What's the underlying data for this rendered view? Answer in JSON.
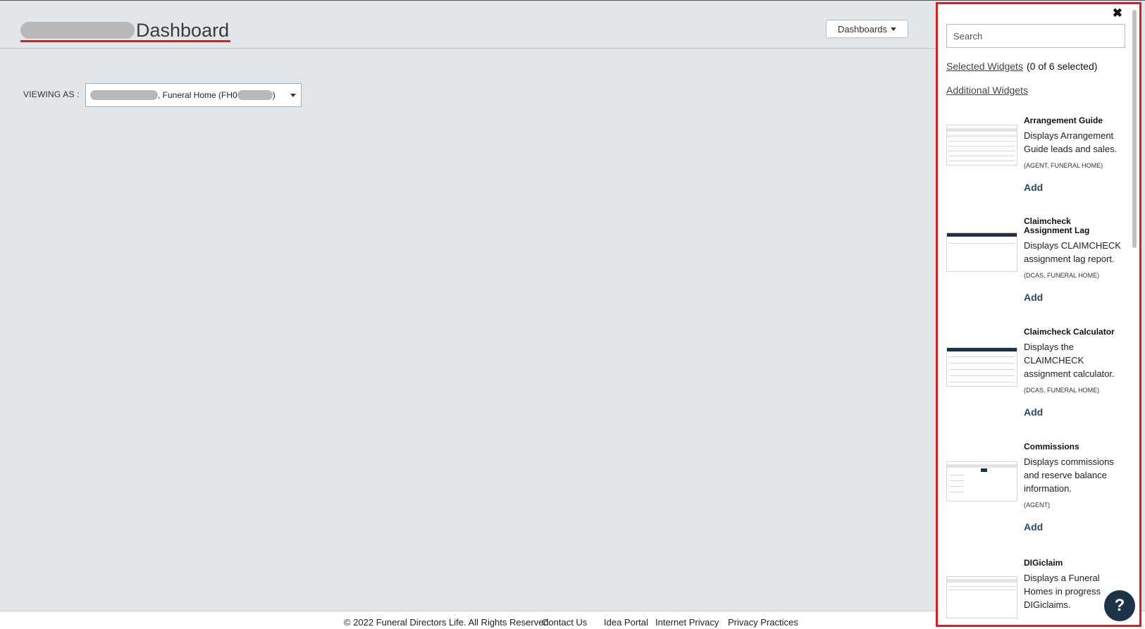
{
  "header": {
    "title": "Dashboard",
    "dashboards_button": "Dashboards"
  },
  "viewing": {
    "label": "VIEWING AS :",
    "value_middle": ", Funeral Home (FH0",
    "value_end": ")"
  },
  "panel": {
    "search_placeholder": "Search",
    "selected_link": "Selected Widgets",
    "selected_count": "(0 of 6 selected)",
    "additional_link": "Additional Widgets",
    "widgets": [
      {
        "name": "Arrangement Guide",
        "desc": "Displays Arrangement Guide leads and sales.",
        "roles": "(AGENT, FUNERAL HOME)",
        "add": "Add"
      },
      {
        "name": "Claimcheck Assignment Lag",
        "desc": "Displays CLAIMCHECK assignment lag report.",
        "roles": "(DCAS, FUNERAL HOME)",
        "add": "Add"
      },
      {
        "name": "Claimcheck Calculator",
        "desc": "Displays the CLAIMCHECK assignment calculator.",
        "roles": "(DCAS, FUNERAL HOME)",
        "add": "Add"
      },
      {
        "name": "Commissions",
        "desc": "Displays commissions and reserve balance information.",
        "roles": "(AGENT)",
        "add": "Add"
      },
      {
        "name": "DIGiclaim",
        "desc": "Displays a Funeral Homes in progress DIGiclaims.",
        "roles": "",
        "add": ""
      }
    ]
  },
  "footer": {
    "copyright": "© 2022 Funeral Directors Life. All Rights Reserved.",
    "contact": "Contact Us",
    "idea": "Idea Portal",
    "internet_privacy": "Internet Privacy",
    "privacy_practices": "Privacy Practices"
  },
  "help": {
    "label": "?"
  },
  "colors": {
    "highlight": "#e01b1b",
    "background": "#e1e6ea",
    "help_button": "#1d3448"
  }
}
